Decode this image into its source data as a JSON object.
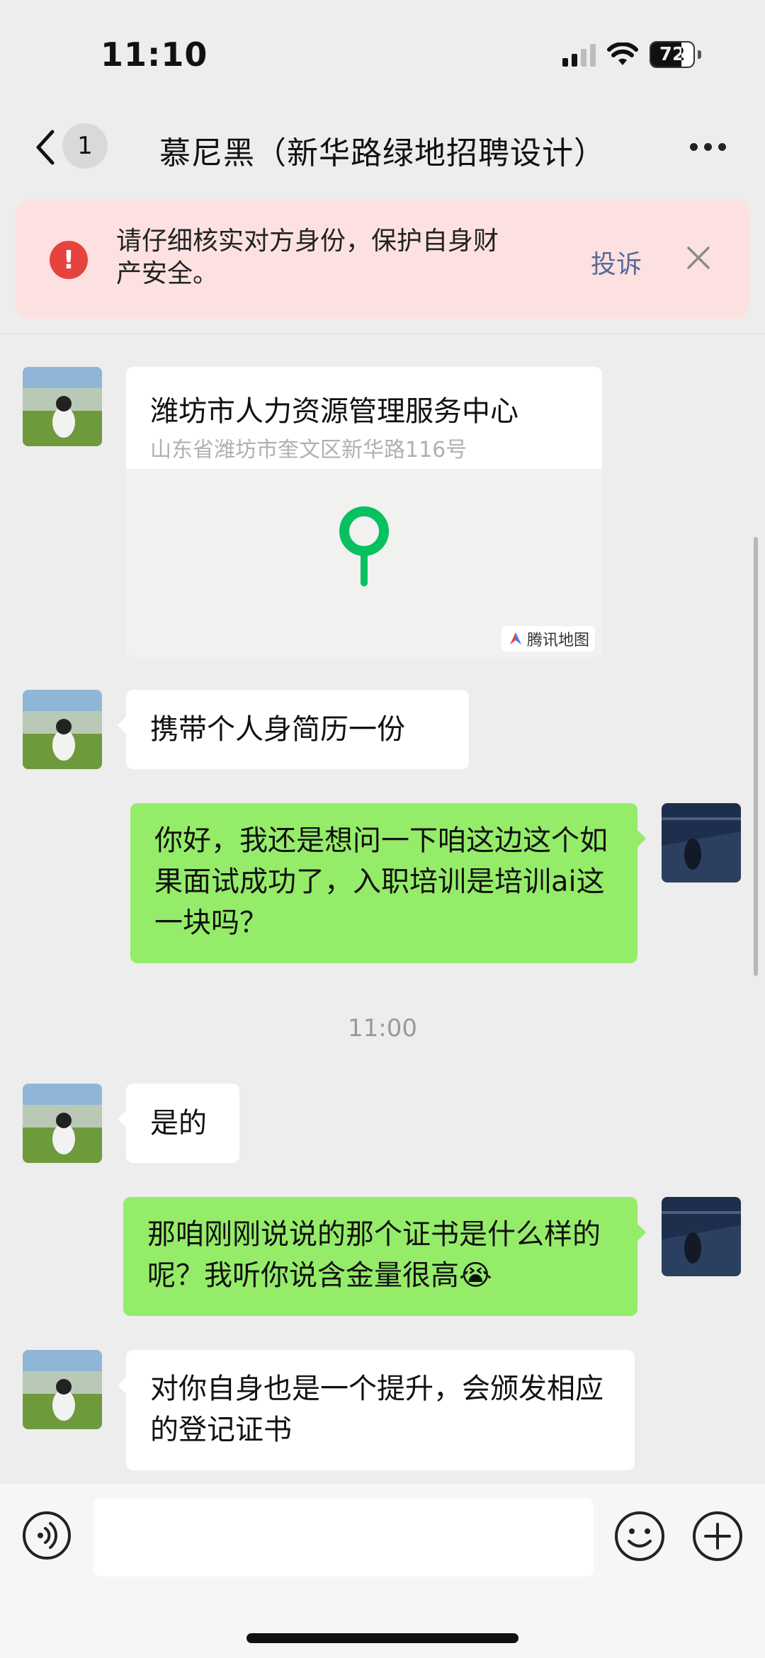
{
  "status": {
    "time": "11:10",
    "battery": "72",
    "battery_level": 0.72
  },
  "nav": {
    "back_count": "1",
    "title": "慕尼黑（新华路绿地招聘设计）"
  },
  "warning": {
    "text": "请仔细核实对方身份，保护自身财产安全。",
    "report": "投诉"
  },
  "messages": {
    "location": {
      "name": "潍坊市人力资源管理服务中心",
      "address": "山东省潍坊市奎文区新华路116号",
      "map_brand": "腾讯地图"
    },
    "m1": "携带个人身简历一份",
    "m2": "你好，我还是想问一下咱这边这个如果面试成功了，入职培训是培训ai这一块吗？",
    "timestamp": "11:00",
    "m3": "是的",
    "m4": "那咱刚刚说说的那个证书是什么样的呢？我听你说含金量很高😭",
    "m5": "对你自身也是一个提升，会颁发相应的登记证书"
  },
  "colors": {
    "sent_bubble": "#95ec69",
    "received_bubble": "#ffffff",
    "warning_bg": "#fde1e1",
    "warning_icon": "#e64340",
    "link": "#576b95",
    "map_pin": "#07c160"
  }
}
